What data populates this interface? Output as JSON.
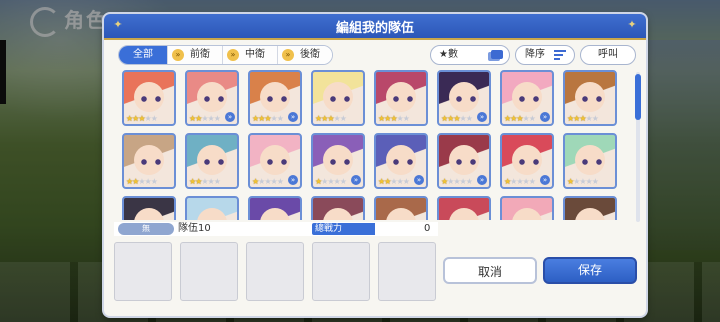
{
  "background": {
    "screen_title": "角色"
  },
  "dialog": {
    "title": "編組我的隊伍"
  },
  "filters": {
    "tabs": [
      {
        "label": "全部",
        "active": true,
        "icon": null
      },
      {
        "label": "前衛",
        "active": false,
        "icon": "position-front-icon"
      },
      {
        "label": "中衛",
        "active": false,
        "icon": "position-middle-icon"
      },
      {
        "label": "後衛",
        "active": false,
        "icon": "position-back-icon"
      }
    ],
    "star_sort_label": "★數",
    "order_label": "降序",
    "call_label": "呼叫"
  },
  "characters": {
    "row1": [
      {
        "hair": "#e9735a",
        "stars": 3,
        "badge": false
      },
      {
        "hair": "#e98a86",
        "stars": 2,
        "badge": true
      },
      {
        "hair": "#d9814a",
        "stars": 3,
        "badge": true
      },
      {
        "hair": "#f2e39a",
        "stars": 3,
        "badge": false
      },
      {
        "hair": "#b9486a",
        "stars": 3,
        "badge": false
      },
      {
        "hair": "#3a2a55",
        "stars": 3,
        "badge": true
      },
      {
        "hair": "#f2a9c0",
        "stars": 3,
        "badge": true
      },
      {
        "hair": "#b9763f",
        "stars": 3,
        "badge": false
      }
    ],
    "row2": [
      {
        "hair": "#c7a585",
        "stars": 2,
        "badge": false
      },
      {
        "hair": "#6fb0c4",
        "stars": 2,
        "badge": false
      },
      {
        "hair": "#f2b3c4",
        "stars": 1,
        "badge": true
      },
      {
        "hair": "#8a5fb8",
        "stars": 1,
        "badge": true
      },
      {
        "hair": "#5b5fb8",
        "stars": 2,
        "badge": true
      },
      {
        "hair": "#9a3a4a",
        "stars": 1,
        "badge": true
      },
      {
        "hair": "#d94a5a",
        "stars": 1,
        "badge": true
      },
      {
        "hair": "#9fd8b8",
        "stars": 1,
        "badge": false
      }
    ],
    "row3": [
      {
        "hair": "#3a3545"
      },
      {
        "hair": "#b7d8ea"
      },
      {
        "hair": "#6a4aa8"
      },
      {
        "hair": "#8a4a5a"
      },
      {
        "hair": "#a9694a"
      },
      {
        "hair": "#c94a5a"
      },
      {
        "hair": "#f2a9b8"
      },
      {
        "hair": "#6a4a3a"
      }
    ]
  },
  "party": {
    "weapon_label": "無",
    "team_label": "隊伍10",
    "power_label": "總戰力",
    "power_value": "0",
    "slots": 5
  },
  "actions": {
    "cancel_label": "取消",
    "save_label": "保存"
  }
}
